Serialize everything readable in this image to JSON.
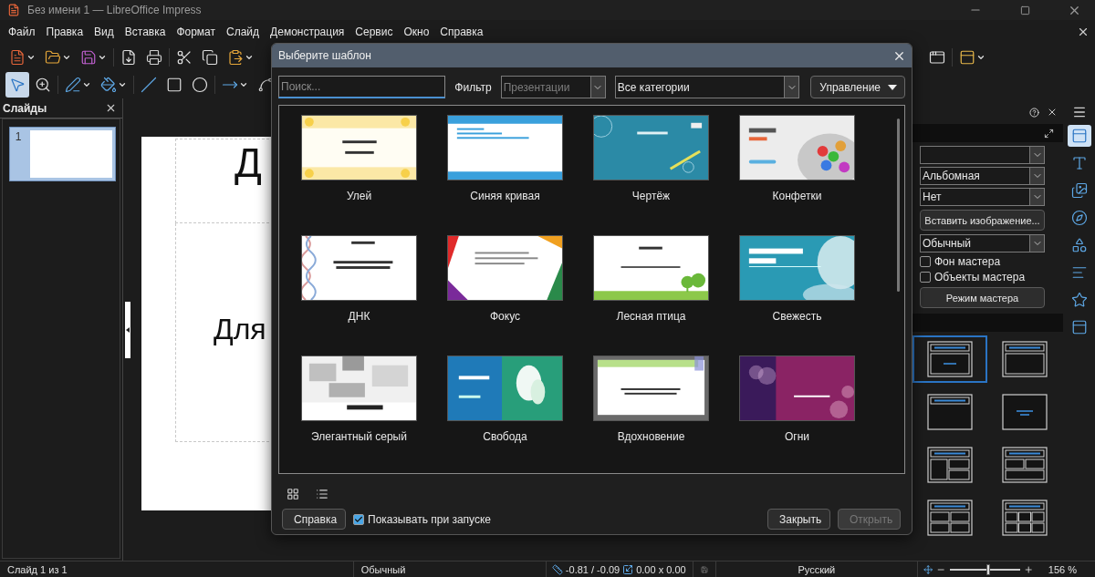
{
  "window": {
    "title": "Без имени 1 — LibreOffice Impress"
  },
  "menu": [
    "Файл",
    "Правка",
    "Вид",
    "Вставка",
    "Формат",
    "Слайд",
    "Демонстрация",
    "Сервис",
    "Окно",
    "Справка"
  ],
  "toolbar_standard": [
    {
      "kind": "new",
      "caret": true
    },
    {
      "kind": "open",
      "caret": true
    },
    {
      "kind": "save",
      "caret": true
    },
    {
      "kind": "pdf",
      "caret": false
    },
    {
      "kind": "print",
      "caret": false
    },
    {
      "kind": "cut",
      "caret": false
    },
    {
      "kind": "copy",
      "caret": false
    },
    {
      "kind": "paste",
      "caret": true
    }
  ],
  "toolbar_standard_right": [
    {
      "kind": "form",
      "caret": false
    },
    {
      "kind": "form-edit",
      "caret": true
    }
  ],
  "toolbar_drawing": [
    {
      "kind": "select",
      "caret": false,
      "selected": true
    },
    {
      "kind": "zoom",
      "caret": false,
      "selected": false
    },
    {
      "kind": "line-color",
      "caret": true,
      "selected": false
    },
    {
      "kind": "fill-color",
      "caret": true,
      "selected": false
    },
    {
      "kind": "line",
      "caret": false,
      "selected": false
    },
    {
      "kind": "rectangle",
      "caret": false,
      "selected": false
    },
    {
      "kind": "ellipse",
      "caret": false,
      "selected": false
    },
    {
      "kind": "arrow",
      "caret": true,
      "selected": false
    },
    {
      "kind": "curve",
      "caret": false,
      "selected": false
    }
  ],
  "slides_pane": {
    "title": "Слайды",
    "slides": [
      {
        "number": "1",
        "selected": true
      }
    ]
  },
  "slide": {
    "title_text": "Д",
    "body_text": "Для"
  },
  "dialog": {
    "title": "Выберите шаблон",
    "search": {
      "placeholder": "Поиск..."
    },
    "filter_label": "Фильтр",
    "filter": {
      "value": "Презентации",
      "disabled": true
    },
    "category": {
      "value": "Все категории",
      "disabled": false
    },
    "manage_button": "Управление",
    "templates": [
      {
        "name": "Улей"
      },
      {
        "name": "Синяя кривая"
      },
      {
        "name": "Чертёж"
      },
      {
        "name": "Конфетки"
      },
      {
        "name": "ДНК"
      },
      {
        "name": "Фокус"
      },
      {
        "name": "Лесная птица"
      },
      {
        "name": "Свежесть"
      },
      {
        "name": "Элегантный серый"
      },
      {
        "name": "Свобода"
      },
      {
        "name": "Вдохновение"
      },
      {
        "name": "Огни"
      }
    ],
    "help_button": "Справка",
    "show_on_startup": {
      "label": "Показывать при запуске",
      "checked": true
    },
    "close_button": {
      "label": "Закрыть",
      "disabled": false
    },
    "open_button": {
      "label": "Открыть",
      "disabled": true
    }
  },
  "sidebar": {
    "fields": [
      {
        "kind": "combo"
      },
      {
        "kind": "combo",
        "value": "Альбомная"
      },
      {
        "kind": "combo",
        "value": "Нет"
      },
      {
        "kind": "button",
        "label": "Вставить изображение..."
      },
      {
        "kind": "combo",
        "value": "Обычный"
      },
      {
        "kind": "checkbox",
        "label": "Фон мастера",
        "checked": false
      },
      {
        "kind": "checkbox",
        "label": "Объекты мастера",
        "checked": false
      },
      {
        "kind": "button",
        "label": "Режим мастера"
      }
    ],
    "layouts": [
      {
        "kind": "title-content",
        "selected": true
      },
      {
        "kind": "title-box",
        "selected": false
      },
      {
        "kind": "title-only",
        "selected": false
      },
      {
        "kind": "centered-text",
        "selected": false
      },
      {
        "kind": "title-content-two",
        "selected": false
      },
      {
        "kind": "title-two-content",
        "selected": false
      },
      {
        "kind": "title-four",
        "selected": false
      },
      {
        "kind": "title-six",
        "selected": false
      }
    ]
  },
  "deck_tabs": [
    {
      "kind": "properties",
      "selected": true
    },
    {
      "kind": "styles",
      "selected": false
    },
    {
      "kind": "gallery",
      "selected": false
    },
    {
      "kind": "navigator",
      "selected": false
    },
    {
      "kind": "shapes",
      "selected": false
    },
    {
      "kind": "master",
      "selected": false
    },
    {
      "kind": "animation",
      "selected": false
    },
    {
      "kind": "transition",
      "selected": false
    }
  ],
  "status_bar": {
    "slide": "Слайд 1 из 1",
    "view": "Обычный",
    "position": "-0.81 / -0.09",
    "size": "0.00 x 0.00",
    "language": "Русский",
    "zoom": {
      "level": 0.55
    },
    "zoom_text": "156 %"
  }
}
